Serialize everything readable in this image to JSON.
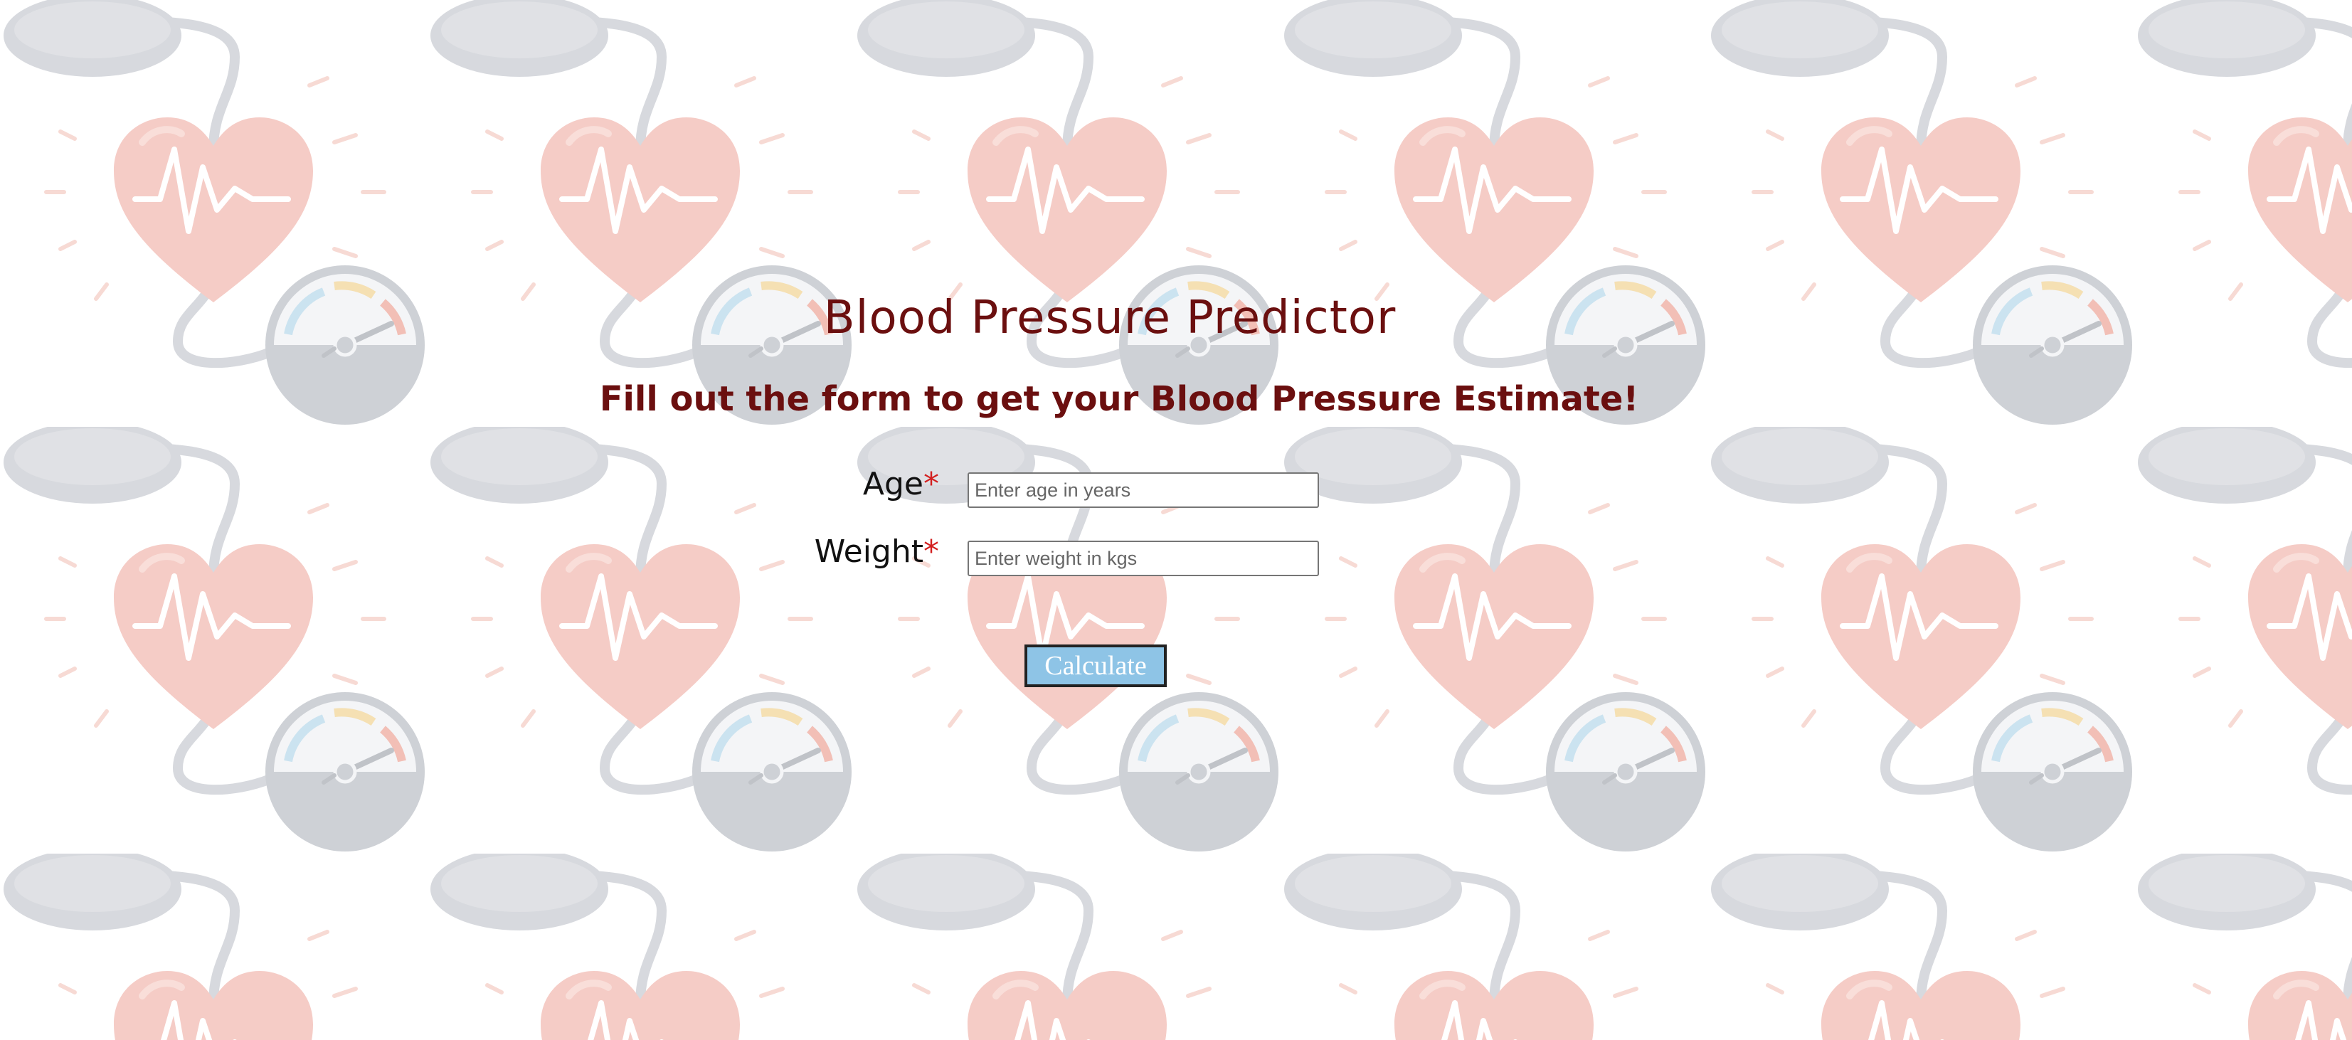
{
  "page": {
    "title": "Blood Pressure Predictor",
    "subtitle": "Fill out the form to get your Blood Pressure Estimate!"
  },
  "form": {
    "age": {
      "label": "Age",
      "required_mark": "*",
      "value": "",
      "placeholder": "Enter age in years"
    },
    "weight": {
      "label": "Weight",
      "required_mark": "*",
      "value": "",
      "placeholder": "Enter weight in kgs"
    },
    "submit_label": "Calculate"
  },
  "background": {
    "pattern": "heart-and-blood-pressure-monitor-icon",
    "colors": {
      "heart": "#f4c6c0",
      "cuff": "#d2d5da",
      "gauge_ring": "#c9ccd1",
      "gauge_face": "#f3f4f6",
      "rays": "#f6d6cf"
    }
  },
  "colors": {
    "heading": "#6b0f0f",
    "required": "#d32020",
    "button_bg": "#8ec4e6"
  }
}
